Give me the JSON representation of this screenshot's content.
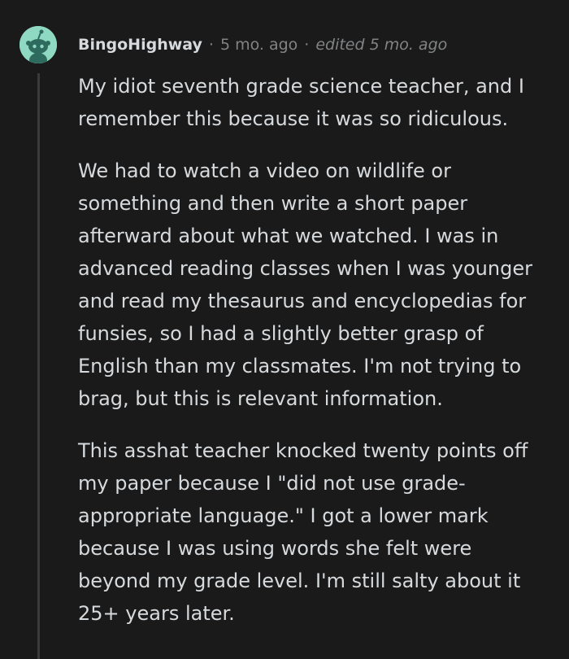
{
  "comment": {
    "author": "BingoHighway",
    "separator": "·",
    "posted": "5 mo. ago",
    "edited": "edited 5 mo. ago",
    "paragraphs": [
      "My idiot seventh grade science teacher, and I\nremember this because it was so ridiculous.",
      "We had to watch a video on wildlife or\nsomething and then write a short paper\nafterward about what we watched. I was in\nadvanced reading classes when I was younger\nand read my thesaurus and encyclopedias for\nfunsies, so I had a slightly better grasp of\nEnglish than my classmates. I'm not trying to\nbrag, but this is relevant information.",
      "This asshat teacher knocked twenty points off\nmy paper because I \"did not use grade-\nappropriate language.\" I got a lower mark\nbecause I was using words she felt were\nbeyond my grade level. I'm still salty about it\n25+ years later."
    ]
  },
  "icons": {
    "avatar": "snoo-avatar-icon"
  },
  "colors": {
    "background": "#1a1a1b",
    "text": "#d7dadc",
    "muted": "#818384",
    "avatar_bg": "#8fd9c2",
    "thread_line": "#3a3a3c"
  }
}
